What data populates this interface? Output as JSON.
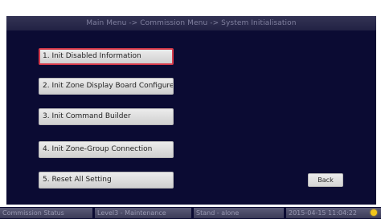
{
  "title_bar": {
    "text": "Main Menu -> Commission Menu -> System Initialisation"
  },
  "menu": {
    "items": [
      {
        "label": "1. Init Disabled Information",
        "selected": true
      },
      {
        "label": "2. Init Zone Display Board Configure",
        "selected": false
      },
      {
        "label": "3. Init Command Builder",
        "selected": false
      },
      {
        "label": "4. Init Zone-Group Connection",
        "selected": false
      },
      {
        "label": "5. Reset All Setting",
        "selected": false
      }
    ]
  },
  "back_button": {
    "label": "Back"
  },
  "status_bar": {
    "commission_status": "Commission Status",
    "level": "Level3 - Maintenance",
    "mode": "Stand - alone",
    "datetime": "2015-04-15 11:04:22",
    "indicator_icon": "sun-icon"
  },
  "colors": {
    "panel_background": "#0b0b33",
    "button_face": "#e0e0e0",
    "selected_border": "#d63a4a",
    "status_indicator": "#f2c61a"
  }
}
